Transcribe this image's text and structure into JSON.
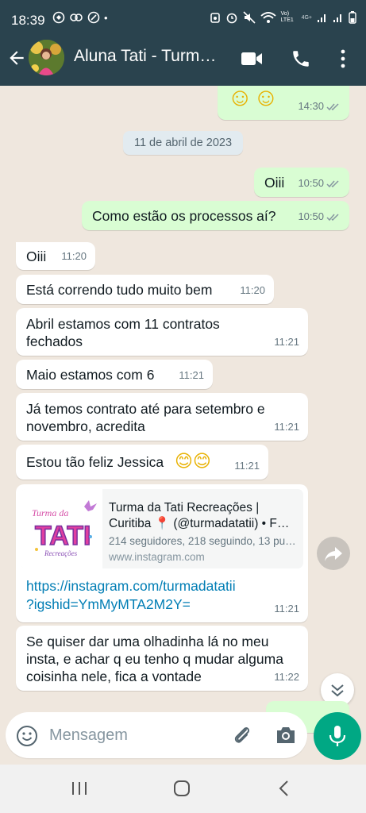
{
  "status_bar": {
    "time": "18:39",
    "dot": "•",
    "network": "Vo) LTE1",
    "network2": "4G+"
  },
  "header": {
    "title": "Aluna Tati - Turm…"
  },
  "date_separator": "11 de abril de 2023",
  "messages": [
    {
      "dir": "out",
      "text": "☺☺",
      "time": "14:30"
    },
    {
      "dir": "out",
      "text": "Oiii",
      "time": "10:50"
    },
    {
      "dir": "out",
      "text": "Como estão os processos aí?",
      "time": "10:50"
    },
    {
      "dir": "in",
      "text": "Oiii",
      "time": "11:20"
    },
    {
      "dir": "in",
      "text": "Está correndo tudo muito bem",
      "time": "11:20"
    },
    {
      "dir": "in",
      "line1": "Abril estamos com 11 contratos",
      "line2": "fechados",
      "time": "11:21"
    },
    {
      "dir": "in",
      "text": "Maio estamos com 6",
      "time": "11:21"
    },
    {
      "dir": "in",
      "line1": "Já temos contrato até para setembro e",
      "line2": "novembro, acredita",
      "time": "11:21"
    },
    {
      "dir": "in",
      "text": "Estou tão feliz Jessica",
      "emoji": "😊😊",
      "time": "11:21"
    },
    {
      "dir": "in",
      "line1": "Se quiser dar uma olhadinha lá no meu",
      "line2": "insta, e achar q eu tenho q mudar alguma",
      "line3": "coisinha nele, fica a vontade",
      "time": "11:22"
    }
  ],
  "link_message": {
    "preview_title_1": "Turma da Tati Recreações |",
    "preview_title_2": "Curitiba 📍 (@turmadatatii) • F…",
    "preview_desc": "214 seguidores, 218 seguindo, 13 pu…",
    "preview_domain": "www.instagram.com",
    "link_line1": "https://instagram.com/turmadatatii",
    "link_line2": "?igshid=YmMyMTA2M2Y=",
    "time": "11:21",
    "logo_text_1": "Turma da",
    "logo_text_2": "TATI",
    "logo_text_3": "Recreações"
  },
  "composer": {
    "placeholder": "Mensagem"
  },
  "colors": {
    "header": "#2a434e",
    "outgoing": "#d9fdd3",
    "incoming": "#ffffff",
    "accent": "#00a884",
    "wallpaper": "#efe7de",
    "ticks": "#8696a0"
  }
}
